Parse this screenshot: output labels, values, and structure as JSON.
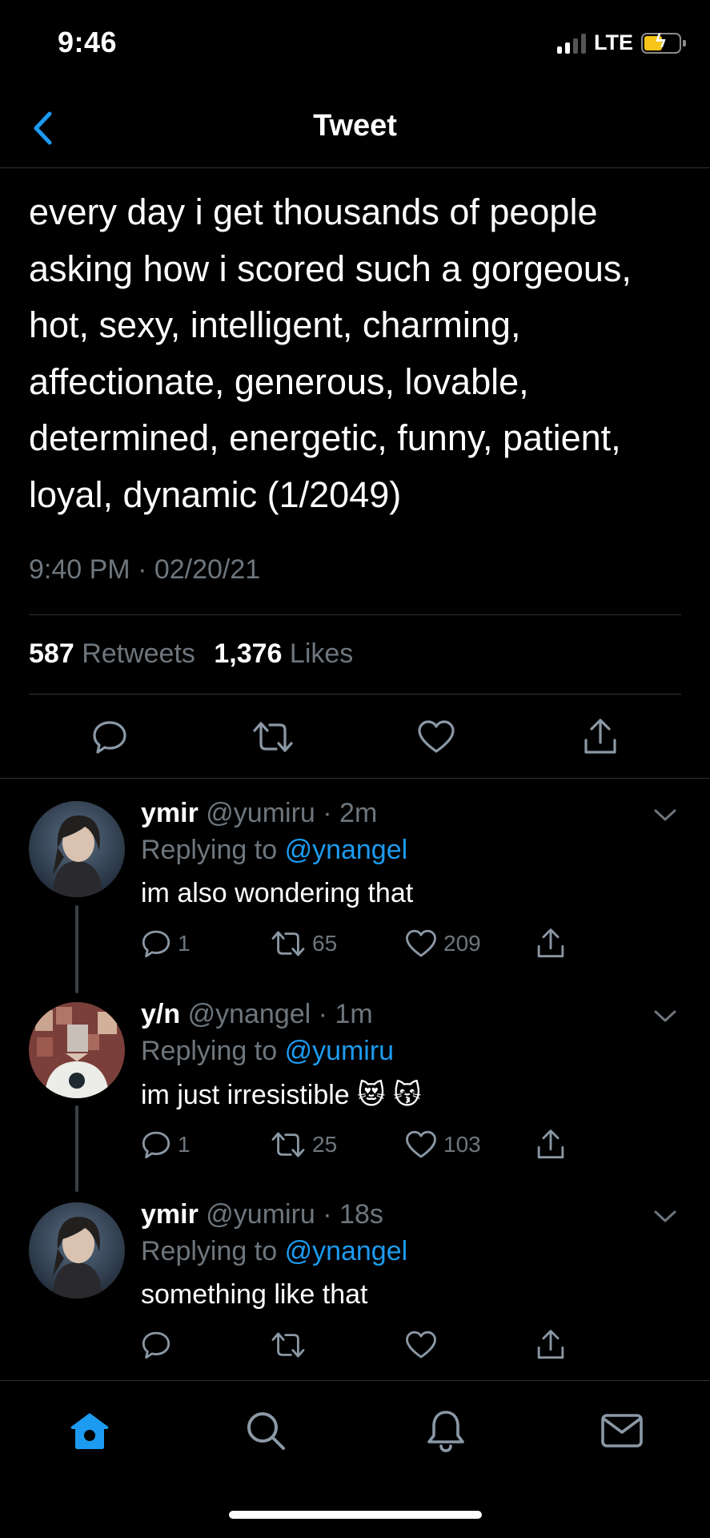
{
  "status_bar": {
    "time": "9:46",
    "network": "LTE",
    "signal_bars": 2,
    "battery_state": "charging"
  },
  "nav": {
    "title": "Tweet",
    "back_icon": "chevron-left-icon"
  },
  "main_tweet": {
    "text": "every day i get thousands of people asking how i scored such a gorgeous, hot, sexy, intelligent, charming, affectionate, generous, lovable, determined, energetic, funny, patient, loyal, dynamic (1/2049)",
    "timestamp": "9:40 PM · 02/20/21",
    "retweets_count": "587",
    "retweets_label": "Retweets",
    "likes_count": "1,376",
    "likes_label": "Likes",
    "actions": [
      "reply-icon",
      "retweet-icon",
      "like-icon",
      "share-icon"
    ]
  },
  "replies": [
    {
      "name": "ymir",
      "handle": "@yumiru",
      "time": "· 2m",
      "replying_prefix": "Replying to",
      "replying_to": "@ynangel",
      "text": "im also wondering that",
      "reply_count": "1",
      "retweet_count": "65",
      "like_count": "209"
    },
    {
      "name": "y/n",
      "handle": "@ynangel",
      "time": "· 1m",
      "replying_prefix": "Replying to",
      "replying_to": "@yumiru",
      "text": "im just irresistible 😻 😽",
      "reply_count": "1",
      "retweet_count": "25",
      "like_count": "103"
    },
    {
      "name": "ymir",
      "handle": "@yumiru",
      "time": "· 18s",
      "replying_prefix": "Replying to",
      "replying_to": "@ynangel",
      "text": "something like that",
      "reply_count": "",
      "retweet_count": "",
      "like_count": ""
    }
  ],
  "tab_bar": {
    "tabs": [
      "home-icon",
      "search-icon",
      "notifications-icon",
      "messages-icon"
    ],
    "active": "home-icon"
  },
  "colors": {
    "background": "#000000",
    "accent": "#1d9bf0",
    "secondary_text": "#6e767d",
    "divider": "#2f3336"
  }
}
